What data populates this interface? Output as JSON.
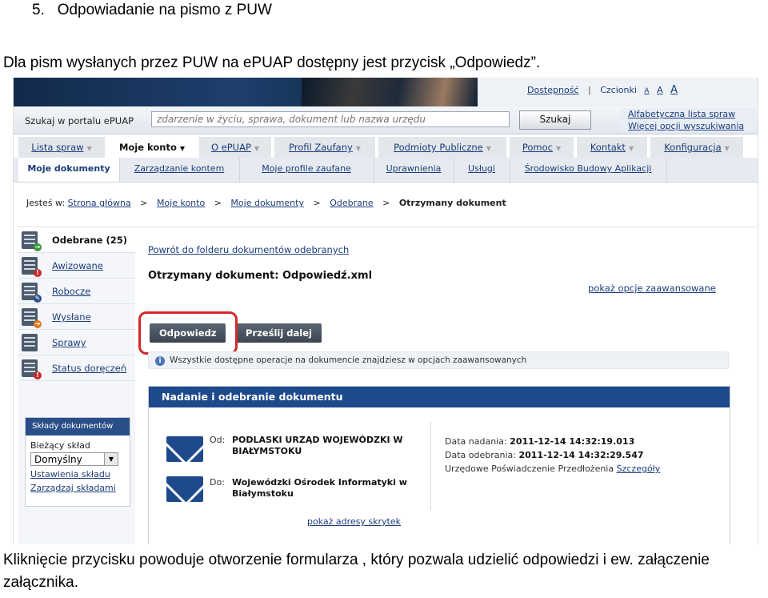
{
  "document": {
    "heading_num": "5.",
    "heading": "Odpowiadanie na pismo z PUW",
    "intro": "Dla pism wysłanych przez PUW na ePUAP dostępny jest przycisk „Odpowiedz”.",
    "caption": "Kliknięcie przycisku powoduje otworzenie formularza , który pozwala udzielić odpowiedzi i ew. załączenie załącznika."
  },
  "top": {
    "accessibility": "Dostępność",
    "separator": "|",
    "fonts_label": "Czcionki",
    "font_small": "A",
    "font_medium": "A",
    "font_large": "A"
  },
  "search": {
    "label": "Szukaj w portalu ePUAP",
    "placeholder": "zdarzenie w życiu, sprawa, dokument lub nazwa urzędu",
    "button": "Szukaj",
    "link_alpha": "Alfabetyczna lista spraw",
    "link_more": "Więcej opcji wyszukiwania"
  },
  "main_nav": [
    {
      "label": "Lista spraw"
    },
    {
      "label": "Moje konto"
    },
    {
      "label": "O ePUAP"
    },
    {
      "label": "Profil Zaufany"
    },
    {
      "label": "Podmioty Publiczne"
    },
    {
      "label": "Pomoc"
    },
    {
      "label": "Kontakt"
    },
    {
      "label": "Konfiguracja"
    }
  ],
  "sub_nav": [
    {
      "label": "Moje dokumenty"
    },
    {
      "label": "Zarządzanie kontem"
    },
    {
      "label": "Moje profile zaufane"
    },
    {
      "label": "Uprawnienia"
    },
    {
      "label": "Usługi"
    },
    {
      "label": "Środowisko Budowy Aplikacji"
    }
  ],
  "breadcrumb": {
    "prefix": "Jesteś w:",
    "items": [
      "Strona główna",
      "Moje konto",
      "Moje dokumenty",
      "Odebrane"
    ],
    "current": "Otrzymany dokument",
    "sep": ">"
  },
  "folders": [
    {
      "label": "Odebrane (25)"
    },
    {
      "label": "Awizowane"
    },
    {
      "label": "Robocze"
    },
    {
      "label": "Wysłane"
    },
    {
      "label": "Sprawy"
    },
    {
      "label": "Status doręczeń"
    }
  ],
  "storage": {
    "header": "Składy dokumentów",
    "current_label": "Bieżący skład",
    "selected": "Domyślny",
    "settings_link": "Ustawienia składu",
    "manage_link": "Zarządzaj składami"
  },
  "content": {
    "back_link": "Powrót do folderu dokumentów odebranych",
    "title": "Otrzymany dokument: Odpowiedź.xml",
    "advanced_link": "pokaż opcje zaawansowane",
    "reply_button": "Odpowiedz",
    "forward_button": "Prześlij dalej",
    "info": "Wszystkie dostępne operacje na dokumencie znajdziesz w opcjach zaawansowanych"
  },
  "delivery": {
    "header": "Nadanie i odebranie dokumentu",
    "from_label": "Od:",
    "from_value": "PODLASKI URZĄD WOJEWÓDZKI W BIAŁYMSTOKU",
    "to_label": "Do:",
    "to_value": "Wojewódzki Ośrodek Informatyki w Białymstoku",
    "sent_label": "Data nadania:",
    "sent_value": "2011-12-14 14:32:19.013",
    "received_label": "Data odebrania:",
    "received_value": "2011-12-14 14:32:29.547",
    "upp_label": "Urzędowe Poświadczenie Przedłożenia",
    "upp_link": "Szczegóły",
    "addresses_link": "pokaż adresy skrytek"
  },
  "colors": {
    "link": "#1b3d7a",
    "header_blue": "#1e4a8c",
    "highlight_red": "#d22a2a"
  }
}
